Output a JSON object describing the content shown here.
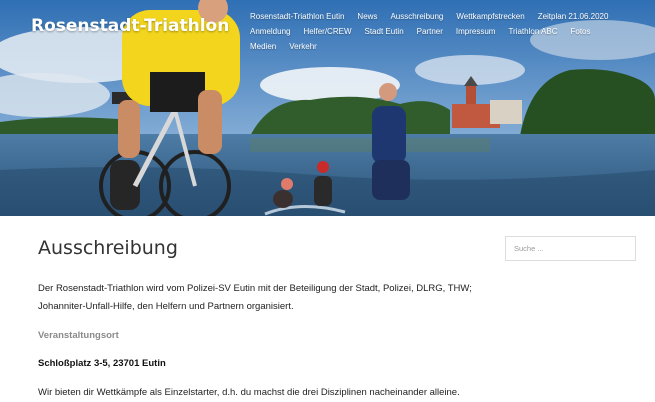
{
  "site": {
    "title": "Rosenstadt-Triathlon"
  },
  "nav": {
    "row1": [
      "Rosenstadt-Triathlon Eutin",
      "News",
      "Ausschreibung",
      "Wettkampfstrecken",
      "Zeitplan 21.06.2020"
    ],
    "row2": [
      "Anmeldung",
      "Helfer/CREW",
      "Stadt Eutin",
      "Partner",
      "Impressum",
      "Triathlon ABC",
      "Fotos"
    ],
    "row3": [
      "Medien",
      "Verkehr"
    ]
  },
  "page": {
    "title": "Ausschreibung",
    "intro": "Der Rosenstadt-Triathlon wird vom Polizei-SV Eutin mit der Beteiligung der Stadt, Polizei, DLRG, THW; Johanniter-Unfall-Hilfe, den Helfern und Partnern organisiert.",
    "venue_heading": "Veranstaltungsort",
    "venue_address": "Schloßplatz 3-5, 23701 Eutin",
    "offer_text": "Wir bieten dir Wettkämpfe als Einzelstarter, d.h. du machst die drei Disziplinen nacheinander alleine."
  },
  "sidebar": {
    "search_placeholder": "Suche ..."
  },
  "colors": {
    "sky": "#5b8fc4",
    "water": "#3d6a94",
    "trees": "#2f5a2a",
    "jersey": "#f2d51c",
    "castle": "#c0593f"
  }
}
